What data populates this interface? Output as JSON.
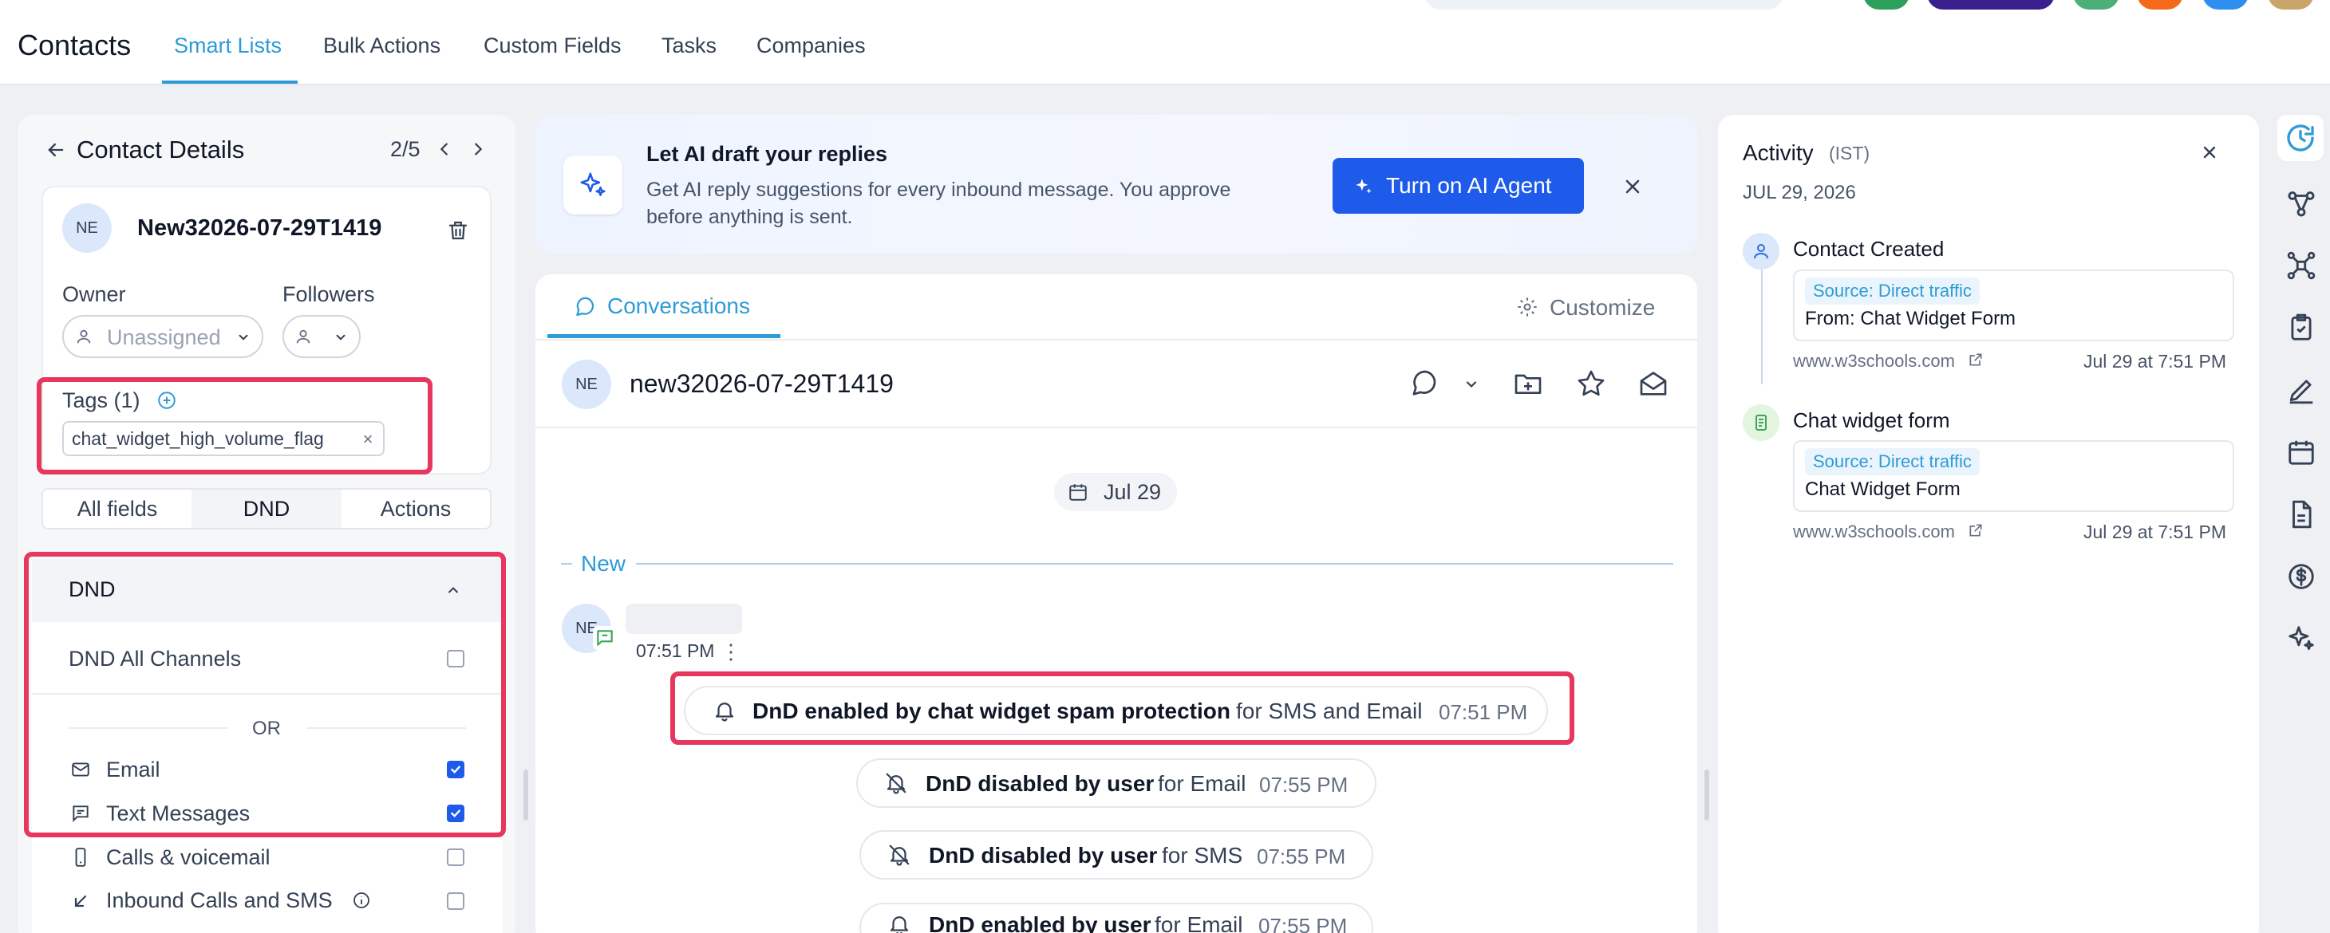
{
  "app": {
    "title": "Contacts",
    "tabs": [
      "Smart Lists",
      "Bulk Actions",
      "Custom Fields",
      "Tasks",
      "Companies"
    ],
    "active_tab": "Smart Lists"
  },
  "contact_panel": {
    "title": "Contact Details",
    "pager": "2/5",
    "avatar_initials": "NE",
    "name": "New32026-07-29T1419",
    "owner_label": "Owner",
    "owner_value": "Unassigned",
    "followers_label": "Followers",
    "tags_label": "Tags (1)",
    "tag": "chat_widget_high_volume_flag",
    "sub_tabs": [
      "All fields",
      "DND",
      "Actions"
    ],
    "active_sub_tab": "DND",
    "dnd": {
      "section_title": "DND",
      "all_channels_label": "DND All Channels",
      "all_channels_checked": false,
      "or_label": "OR",
      "channels": [
        {
          "label": "Email",
          "checked": true
        },
        {
          "label": "Text Messages",
          "checked": true
        },
        {
          "label": "Calls & voicemail",
          "checked": false
        },
        {
          "label": "Inbound Calls and SMS",
          "checked": false
        }
      ]
    }
  },
  "ai_banner": {
    "title": "Let AI draft your replies",
    "body_line1": "Get AI reply suggestions for every inbound message. You approve",
    "body_line2": "before anything is sent.",
    "button": "Turn on AI Agent"
  },
  "conversation": {
    "tab": "Conversations",
    "customize": "Customize",
    "avatar_initials": "NE",
    "contact_name": "new32026-07-29T1419",
    "date_chip": "Jul 29",
    "new_label": "New",
    "message_avatar": "NE",
    "message_time": "07:51 PM",
    "events": [
      {
        "bold": "DnD enabled by chat widget spam protection",
        "rest": "for SMS and Email",
        "time": "07:51 PM"
      },
      {
        "bold": "DnD disabled by user",
        "rest": "for Email",
        "time": "07:55 PM"
      },
      {
        "bold": "DnD disabled by user",
        "rest": "for SMS",
        "time": "07:55 PM"
      },
      {
        "bold": "DnD enabled by user",
        "rest": "for Email",
        "time": "07:55 PM"
      }
    ]
  },
  "activity": {
    "title": "Activity",
    "timezone": "(IST)",
    "date": "JUL 29, 2026",
    "items": [
      {
        "title": "Contact Created",
        "source": "Source: Direct traffic",
        "detail": "From: Chat Widget Form",
        "link": "www.w3schools.com",
        "time": "Jul 29 at 7:51 PM"
      },
      {
        "title": "Chat widget form",
        "source": "Source: Direct traffic",
        "detail": "Chat Widget Form",
        "link": "www.w3schools.com",
        "time": "Jul 29 at 7:51 PM"
      }
    ]
  },
  "colors": {
    "accent": "#2e9bd6",
    "primary_button": "#1e5bea",
    "highlight": "#e8375e"
  }
}
